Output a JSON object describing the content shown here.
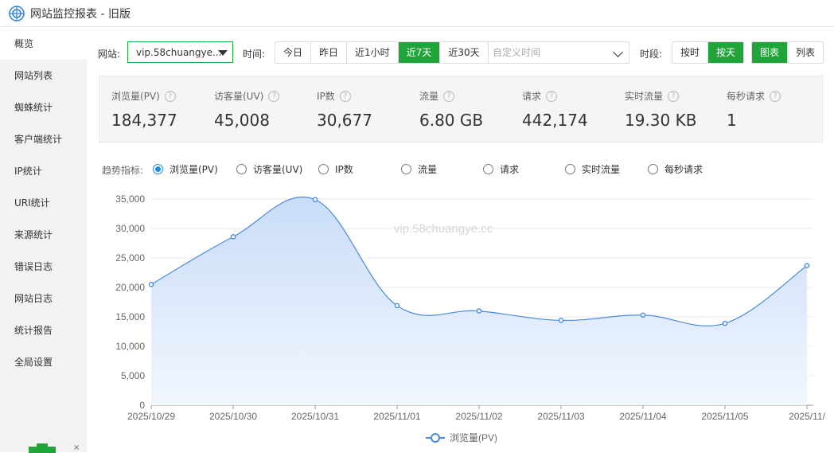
{
  "window": {
    "title": "网站监控报表 - 旧版"
  },
  "sidebar": {
    "items": [
      {
        "label": "概览",
        "active": true
      },
      {
        "label": "网站列表"
      },
      {
        "label": "蜘蛛统计"
      },
      {
        "label": "客户端统计"
      },
      {
        "label": "IP统计"
      },
      {
        "label": "URI统计"
      },
      {
        "label": "来源统计"
      },
      {
        "label": "错误日志"
      },
      {
        "label": "网站日志"
      },
      {
        "label": "统计报告"
      },
      {
        "label": "全局设置"
      }
    ],
    "close_glyph": "×"
  },
  "toolbar": {
    "site_label": "网站:",
    "site_value": "vip.58chuangye...",
    "time_label": "时间:",
    "time_buttons": [
      "今日",
      "昨日",
      "近1小时",
      "近7天",
      "近30天"
    ],
    "time_active": "近7天",
    "custom_time_placeholder": "自定义时间",
    "period_label": "时段:",
    "period_buttons": [
      "按时",
      "按天"
    ],
    "period_active": "按天",
    "view_buttons": [
      "图表",
      "列表"
    ],
    "view_active": "图表"
  },
  "stats": [
    {
      "name": "浏览量(PV)",
      "value": "184,377"
    },
    {
      "name": "访客量(UV)",
      "value": "45,008"
    },
    {
      "name": "IP数",
      "value": "30,677"
    },
    {
      "name": "流量",
      "value": "6.80 GB"
    },
    {
      "name": "请求",
      "value": "442,174"
    },
    {
      "name": "实时流量",
      "value": "19.30 KB"
    },
    {
      "name": "每秒请求",
      "value": "1"
    }
  ],
  "stats_help_glyph": "?",
  "trend": {
    "label": "趋势指标:",
    "options": [
      "浏览量(PV)",
      "访客量(UV)",
      "IP数",
      "流量",
      "请求",
      "实时流量",
      "每秒请求"
    ],
    "selected": "浏览量(PV)"
  },
  "chart_data": {
    "type": "area",
    "watermark": "vip.58chuangye.cc",
    "categories": [
      "2025/10/29",
      "2025/10/30",
      "2025/10/31",
      "2025/11/01",
      "2025/11/02",
      "2025/11/03",
      "2025/11/04",
      "2025/11/05",
      "2025/11/"
    ],
    "series": [
      {
        "name": "浏览量(PV)",
        "values": [
          20500,
          28600,
          34900,
          16900,
          16000,
          14400,
          15300,
          13900,
          23700
        ]
      }
    ],
    "ylim": [
      0,
      35000
    ],
    "yticks": [
      0,
      5000,
      10000,
      15000,
      20000,
      25000,
      30000,
      35000
    ],
    "ytick_labels": [
      "0",
      "5,000",
      "10,000",
      "15,000",
      "20,000",
      "25,000",
      "30,000",
      "35,000"
    ],
    "grid": true,
    "legend_position": "bottom-center",
    "colors": {
      "line": "#4a8ae0",
      "fill_top": "#c9dcf8",
      "fill_bottom": "#f2f7fe"
    }
  }
}
